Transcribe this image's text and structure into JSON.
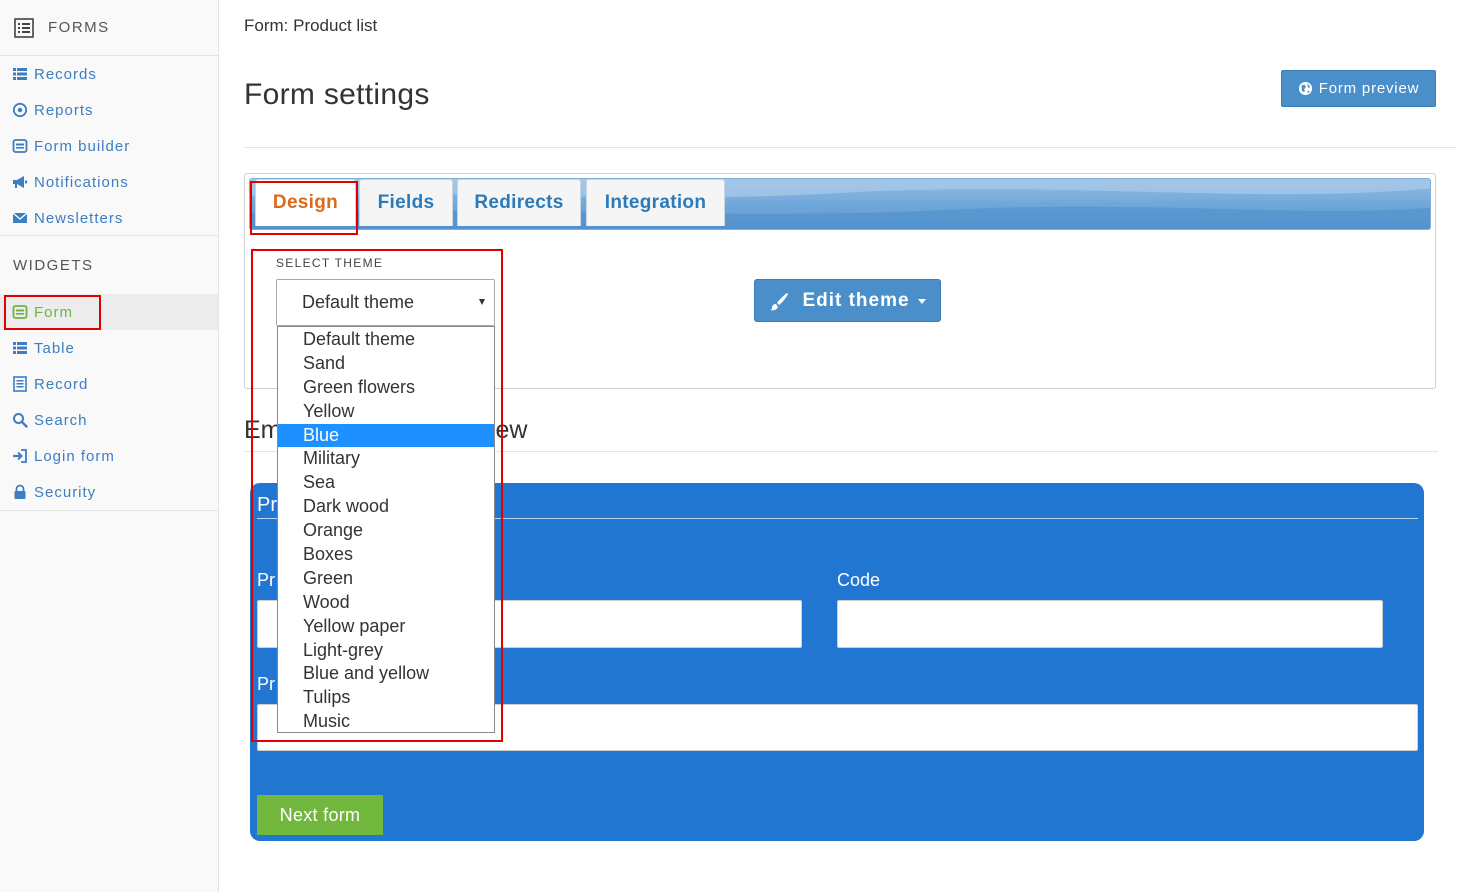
{
  "sidebar": {
    "header": "FORMS",
    "items": [
      {
        "label": "Records",
        "icon": "list-icon"
      },
      {
        "label": "Reports",
        "icon": "target-icon"
      },
      {
        "label": "Form builder",
        "icon": "form-icon"
      },
      {
        "label": "Notifications",
        "icon": "bullhorn-icon"
      },
      {
        "label": "Newsletters",
        "icon": "envelope-icon"
      }
    ],
    "widgets_title": "WIDGETS",
    "widgets": [
      {
        "label": "Form",
        "icon": "form-icon"
      },
      {
        "label": "Table",
        "icon": "list-icon"
      },
      {
        "label": "Record",
        "icon": "document-icon"
      },
      {
        "label": "Search",
        "icon": "search-icon"
      },
      {
        "label": "Login form",
        "icon": "sign-in-icon"
      },
      {
        "label": "Security",
        "icon": "lock-icon"
      }
    ]
  },
  "header": {
    "breadcrumb": "Form: Product list",
    "title": "Form settings",
    "preview_button": "Form preview"
  },
  "tabs": [
    "Design",
    "Fields",
    "Redirects",
    "Integration"
  ],
  "theme": {
    "label": "SELECT THEME",
    "selected": "Default theme",
    "highlighted": "Blue",
    "options": [
      "Default theme",
      "Sand",
      "Green flowers",
      "Yellow",
      "Blue",
      "Military",
      "Sea",
      "Dark wood",
      "Orange",
      "Boxes",
      "Green",
      "Wood",
      "Yellow paper",
      "Light-grey",
      "Blue and yellow",
      "Tulips",
      "Music"
    ],
    "edit_button": "Edit theme"
  },
  "embed": {
    "title_left": "Em",
    "title_right": "ew"
  },
  "form_preview": {
    "title_visible": "Pr",
    "field1_label_visible": "Pr",
    "field2_label": "Code",
    "field3_label_visible": "Pr",
    "next_button": "Next form"
  },
  "colors": {
    "accent_blue": "#4a8fca",
    "link_blue": "#3c7ec1",
    "active_green": "#6eb443",
    "active_tab_orange": "#d96a1e",
    "preview_bg": "#2176d2",
    "next_button_green": "#71b73e",
    "highlight_blue": "#1e90ff",
    "annotation_red": "#e00000"
  }
}
